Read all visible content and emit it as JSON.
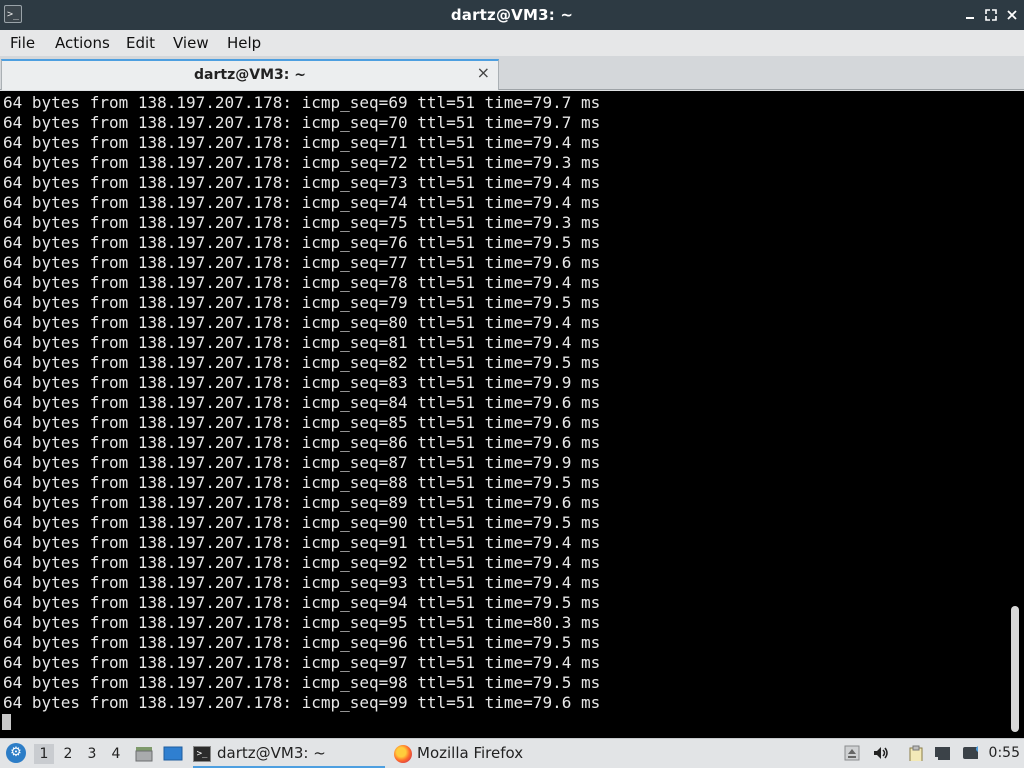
{
  "window": {
    "title": "dartz@VM3: ~",
    "controls": {
      "minimize": "_",
      "maximize": "⤢",
      "close": "✕"
    }
  },
  "menu": [
    "File",
    "Actions",
    "Edit",
    "View",
    "Help"
  ],
  "tabs": [
    {
      "label": "dartz@VM3: ~",
      "close": "×"
    }
  ],
  "terminal": {
    "lines": [
      "64 bytes from 138.197.207.178: icmp_seq=69 ttl=51 time=79.7 ms",
      "64 bytes from 138.197.207.178: icmp_seq=70 ttl=51 time=79.7 ms",
      "64 bytes from 138.197.207.178: icmp_seq=71 ttl=51 time=79.4 ms",
      "64 bytes from 138.197.207.178: icmp_seq=72 ttl=51 time=79.3 ms",
      "64 bytes from 138.197.207.178: icmp_seq=73 ttl=51 time=79.4 ms",
      "64 bytes from 138.197.207.178: icmp_seq=74 ttl=51 time=79.4 ms",
      "64 bytes from 138.197.207.178: icmp_seq=75 ttl=51 time=79.3 ms",
      "64 bytes from 138.197.207.178: icmp_seq=76 ttl=51 time=79.5 ms",
      "64 bytes from 138.197.207.178: icmp_seq=77 ttl=51 time=79.6 ms",
      "64 bytes from 138.197.207.178: icmp_seq=78 ttl=51 time=79.4 ms",
      "64 bytes from 138.197.207.178: icmp_seq=79 ttl=51 time=79.5 ms",
      "64 bytes from 138.197.207.178: icmp_seq=80 ttl=51 time=79.4 ms",
      "64 bytes from 138.197.207.178: icmp_seq=81 ttl=51 time=79.4 ms",
      "64 bytes from 138.197.207.178: icmp_seq=82 ttl=51 time=79.5 ms",
      "64 bytes from 138.197.207.178: icmp_seq=83 ttl=51 time=79.9 ms",
      "64 bytes from 138.197.207.178: icmp_seq=84 ttl=51 time=79.6 ms",
      "64 bytes from 138.197.207.178: icmp_seq=85 ttl=51 time=79.6 ms",
      "64 bytes from 138.197.207.178: icmp_seq=86 ttl=51 time=79.6 ms",
      "64 bytes from 138.197.207.178: icmp_seq=87 ttl=51 time=79.9 ms",
      "64 bytes from 138.197.207.178: icmp_seq=88 ttl=51 time=79.5 ms",
      "64 bytes from 138.197.207.178: icmp_seq=89 ttl=51 time=79.6 ms",
      "64 bytes from 138.197.207.178: icmp_seq=90 ttl=51 time=79.5 ms",
      "64 bytes from 138.197.207.178: icmp_seq=91 ttl=51 time=79.4 ms",
      "64 bytes from 138.197.207.178: icmp_seq=92 ttl=51 time=79.4 ms",
      "64 bytes from 138.197.207.178: icmp_seq=93 ttl=51 time=79.4 ms",
      "64 bytes from 138.197.207.178: icmp_seq=94 ttl=51 time=79.5 ms",
      "64 bytes from 138.197.207.178: icmp_seq=95 ttl=51 time=80.3 ms",
      "64 bytes from 138.197.207.178: icmp_seq=96 ttl=51 time=79.5 ms",
      "64 bytes from 138.197.207.178: icmp_seq=97 ttl=51 time=79.4 ms",
      "64 bytes from 138.197.207.178: icmp_seq=98 ttl=51 time=79.5 ms",
      "64 bytes from 138.197.207.178: icmp_seq=99 ttl=51 time=79.6 ms"
    ]
  },
  "taskbar": {
    "start_icon": "⚙",
    "workspaces": [
      "1",
      "2",
      "3",
      "4"
    ],
    "active_workspace": "1",
    "tasks": [
      {
        "label": "dartz@VM3: ~",
        "icon": "terminal-icon",
        "active": true
      },
      {
        "label": "Mozilla Firefox",
        "icon": "firefox-icon",
        "active": false
      }
    ],
    "clock": "0:55",
    "colors": {
      "accent": "#4d9fe0",
      "titlebar": "#2d3a43",
      "terminal_bg": "#000000"
    }
  }
}
